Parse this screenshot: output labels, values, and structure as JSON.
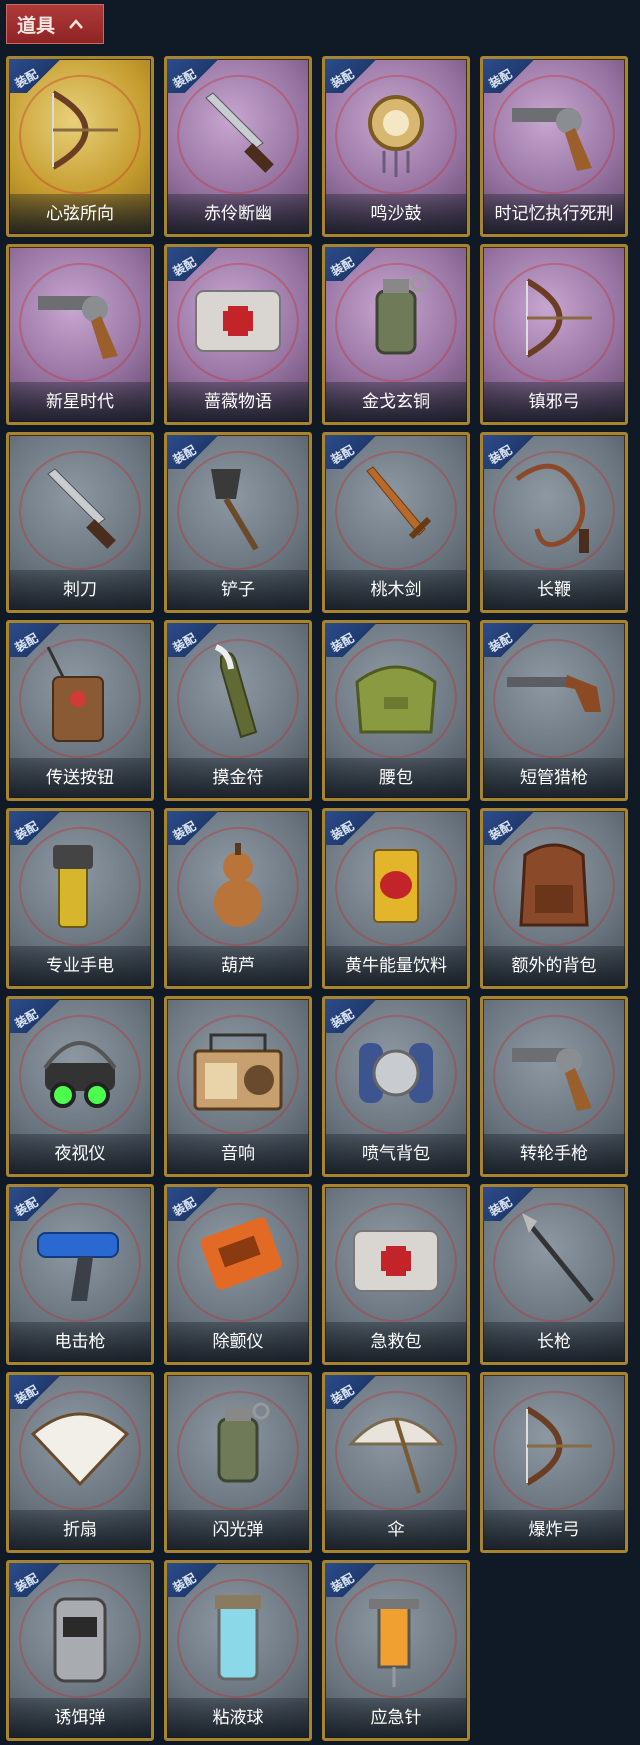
{
  "header": {
    "label": "道具"
  },
  "equip_badge": "装配",
  "items": [
    {
      "label": "心弦所向",
      "rarity": "gold",
      "equip": true,
      "icon": "bow-icon"
    },
    {
      "label": "赤伶断幽",
      "rarity": "purple",
      "equip": true,
      "icon": "knife-icon"
    },
    {
      "label": "鸣沙鼓",
      "rarity": "purple",
      "equip": true,
      "icon": "drum-icon"
    },
    {
      "label": "时记忆执行死刑",
      "rarity": "purple",
      "equip": true,
      "icon": "revolver-icon"
    },
    {
      "label": "新星时代",
      "rarity": "purple",
      "equip": false,
      "icon": "revolver-icon"
    },
    {
      "label": "蔷薇物语",
      "rarity": "purple",
      "equip": true,
      "icon": "medkit-icon"
    },
    {
      "label": "金戈玄铜",
      "rarity": "purple",
      "equip": true,
      "icon": "grenade-icon"
    },
    {
      "label": "镇邪弓",
      "rarity": "purple",
      "equip": false,
      "icon": "bow-icon"
    },
    {
      "label": "刺刀",
      "rarity": "grey",
      "equip": false,
      "icon": "knife-icon"
    },
    {
      "label": "铲子",
      "rarity": "grey",
      "equip": true,
      "icon": "shovel-icon"
    },
    {
      "label": "桃木剑",
      "rarity": "grey",
      "equip": true,
      "icon": "sword-icon"
    },
    {
      "label": "长鞭",
      "rarity": "grey",
      "equip": true,
      "icon": "whip-icon"
    },
    {
      "label": "传送按钮",
      "rarity": "grey",
      "equip": true,
      "icon": "remote-icon"
    },
    {
      "label": "摸金符",
      "rarity": "grey",
      "equip": true,
      "icon": "charm-icon"
    },
    {
      "label": "腰包",
      "rarity": "grey",
      "equip": true,
      "icon": "bag-icon"
    },
    {
      "label": "短管猎枪",
      "rarity": "grey",
      "equip": true,
      "icon": "shotgun-icon"
    },
    {
      "label": "专业手电",
      "rarity": "grey",
      "equip": true,
      "icon": "flashlight-icon"
    },
    {
      "label": "葫芦",
      "rarity": "grey",
      "equip": true,
      "icon": "gourd-icon"
    },
    {
      "label": "黄牛能量饮料",
      "rarity": "grey",
      "equip": true,
      "icon": "can-icon"
    },
    {
      "label": "额外的背包",
      "rarity": "grey",
      "equip": true,
      "icon": "backpack-icon"
    },
    {
      "label": "夜视仪",
      "rarity": "grey",
      "equip": true,
      "icon": "goggles-icon"
    },
    {
      "label": "音响",
      "rarity": "grey",
      "equip": false,
      "icon": "radio-icon"
    },
    {
      "label": "喷气背包",
      "rarity": "grey",
      "equip": true,
      "icon": "jetpack-icon"
    },
    {
      "label": "转轮手枪",
      "rarity": "grey",
      "equip": false,
      "icon": "revolver-icon"
    },
    {
      "label": "电击枪",
      "rarity": "grey",
      "equip": true,
      "icon": "taser-icon"
    },
    {
      "label": "除颤仪",
      "rarity": "grey",
      "equip": true,
      "icon": "defibrillator-icon"
    },
    {
      "label": "急救包",
      "rarity": "grey",
      "equip": false,
      "icon": "medkit-icon"
    },
    {
      "label": "长枪",
      "rarity": "grey",
      "equip": true,
      "icon": "spear-icon"
    },
    {
      "label": "折扇",
      "rarity": "grey",
      "equip": true,
      "icon": "fan-icon"
    },
    {
      "label": "闪光弹",
      "rarity": "grey",
      "equip": false,
      "icon": "grenade-icon"
    },
    {
      "label": "伞",
      "rarity": "grey",
      "equip": true,
      "icon": "umbrella-icon"
    },
    {
      "label": "爆炸弓",
      "rarity": "grey",
      "equip": false,
      "icon": "bow-icon"
    },
    {
      "label": "诱饵弹",
      "rarity": "grey",
      "equip": true,
      "icon": "canister-icon"
    },
    {
      "label": "粘液球",
      "rarity": "grey",
      "equip": true,
      "icon": "vial-icon"
    },
    {
      "label": "应急针",
      "rarity": "grey",
      "equip": true,
      "icon": "syringe-icon"
    }
  ]
}
